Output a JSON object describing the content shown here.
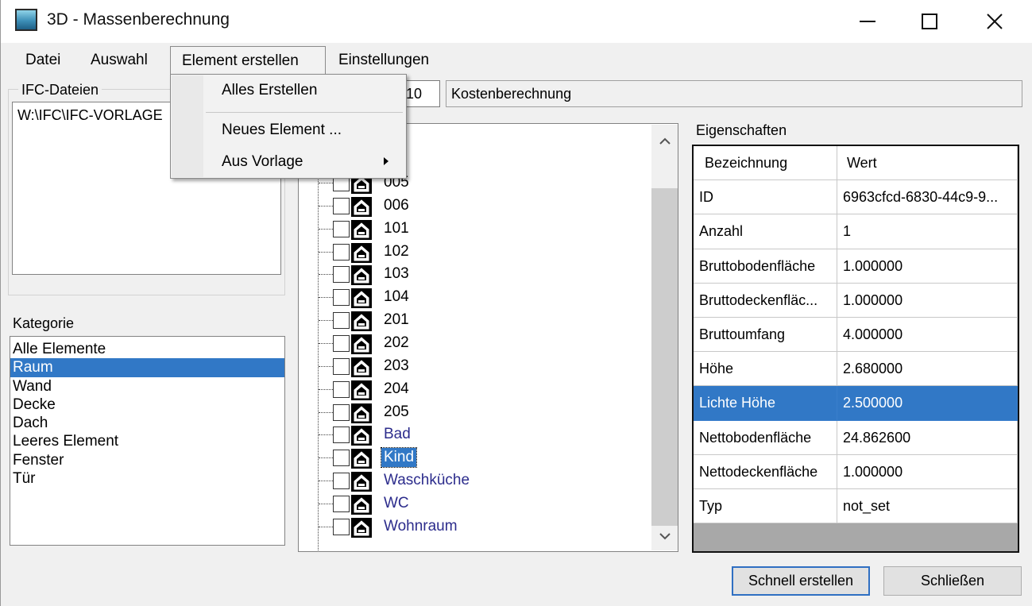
{
  "window": {
    "title": "3D - Massenberechnung",
    "icon": "app-window-icon",
    "controls": {
      "minimize": "—",
      "maximize": "☐",
      "close": "✕"
    }
  },
  "menu": {
    "items": [
      "Datei",
      "Auswahl",
      "Element erstellen",
      "Einstellungen"
    ],
    "open_index": 2,
    "dropdown": {
      "items": [
        "Alles Erstellen",
        "Neues Element ...",
        "Aus Vorlage"
      ],
      "submenu_index": 2
    }
  },
  "ifc": {
    "label": "IFC-Dateien",
    "path": "W:\\IFC\\IFC-VORLAGE"
  },
  "top_fields": {
    "number_value": "10",
    "cost_value": "Kostenberechnung"
  },
  "kategorie": {
    "label": "Kategorie",
    "items": [
      "Alle Elemente",
      "Raum",
      "Wand",
      "Decke",
      "Dach",
      "Leeres Element",
      "Fenster",
      "Tür"
    ],
    "selected_index": 1
  },
  "tree": {
    "items": [
      "005",
      "006",
      "101",
      "102",
      "103",
      "104",
      "201",
      "202",
      "203",
      "204",
      "205",
      "Bad",
      "Kind",
      "Waschküche",
      "WC",
      "Wohnraum"
    ],
    "blue_from_index": 11,
    "selected_index": 12,
    "icon": "room-house-icon"
  },
  "properties": {
    "label": "Eigenschaften",
    "headers": [
      "Bezeichnung",
      "Wert"
    ],
    "rows": [
      [
        "ID",
        "6963cfcd-6830-44c9-9..."
      ],
      [
        "Anzahl",
        "1"
      ],
      [
        "Bruttobodenfläche",
        "1.000000"
      ],
      [
        "Bruttodeckenfläc...",
        "1.000000"
      ],
      [
        "Bruttoumfang",
        "4.000000"
      ],
      [
        "Höhe",
        "2.680000"
      ],
      [
        "Lichte Höhe",
        "2.500000"
      ],
      [
        "Nettobodenfläche",
        "24.862600"
      ],
      [
        "Nettodeckenfläche",
        "1.000000"
      ],
      [
        "Typ",
        "not_set"
      ]
    ],
    "selected_index": 6
  },
  "buttons": {
    "quick_create": "Schnell erstellen",
    "close": "Schließen"
  },
  "colors": {
    "selection": "#3178c6",
    "tree_blue_text": "#2c2c8c",
    "default_button_border": "#2f6fc2"
  }
}
